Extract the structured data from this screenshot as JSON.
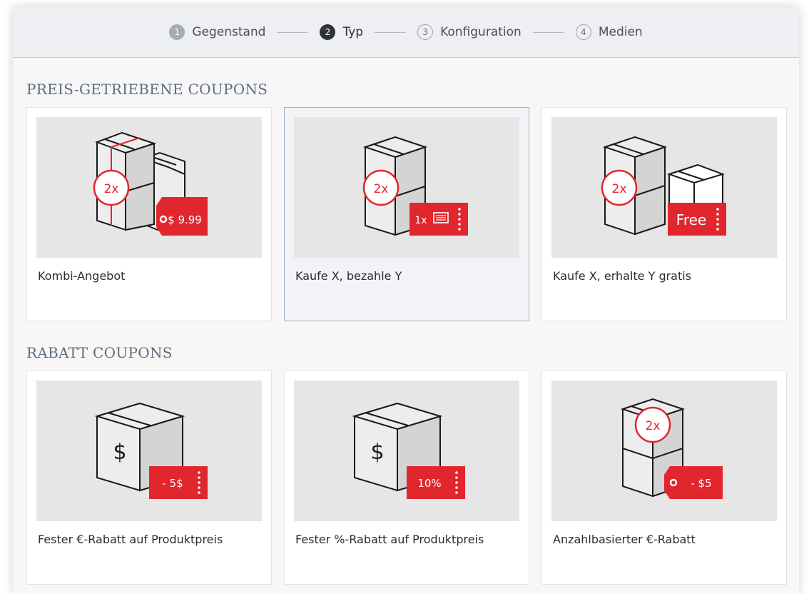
{
  "stepper": {
    "steps": [
      {
        "number": "1",
        "label": "Gegenstand",
        "state": "done"
      },
      {
        "number": "2",
        "label": "Typ",
        "state": "active"
      },
      {
        "number": "3",
        "label": "Konfiguration",
        "state": "todo"
      },
      {
        "number": "4",
        "label": "Medien",
        "state": "todo"
      }
    ]
  },
  "sections": [
    {
      "title": "PREIS-GETRIEBENE COUPONS",
      "cards": [
        {
          "label": "Kombi-Angebot",
          "badge": "2x",
          "tag": "$ 9.99",
          "icon": "bundle-boxes-icon",
          "selected": false
        },
        {
          "label": "Kaufe X, bezahle Y",
          "badge": "2x",
          "tag": "1x",
          "icon": "buy-x-pay-y-icon",
          "selected": true
        },
        {
          "label": "Kaufe X, erhalte Y gratis",
          "badge": "2x",
          "tag": "Free",
          "icon": "buy-x-get-y-free-icon",
          "selected": false
        }
      ]
    },
    {
      "title": "RABATT COUPONS",
      "cards": [
        {
          "label": "Fester €-Rabatt auf Produktpreis",
          "box_symbol": "$",
          "tag": "- 5$",
          "icon": "fixed-amount-discount-icon",
          "selected": false
        },
        {
          "label": "Fester %-Rabatt auf Produktpreis",
          "box_symbol": "$",
          "tag": "10%",
          "icon": "percent-discount-icon",
          "selected": false
        },
        {
          "label": "Anzahlbasierter €-Rabatt",
          "badge": "2x",
          "tag": "- $5",
          "icon": "quantity-discount-icon",
          "selected": false
        }
      ]
    }
  ],
  "colors": {
    "accent_red": "#e2262d",
    "box_light": "#ededed",
    "box_mid": "#d4d4d4",
    "outline": "#1a1a1a",
    "section_title": "#5d6c80"
  }
}
